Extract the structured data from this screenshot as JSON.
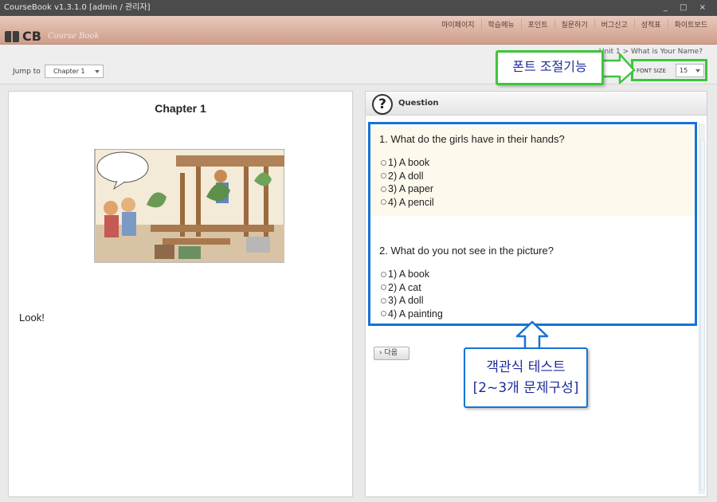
{
  "window": {
    "title": "CourseBook v1.3.1.0 [admin / 관리자]",
    "controls": "_ □ ×"
  },
  "header": {
    "logo_text": "CB",
    "logo_script": "Course Book",
    "menu": [
      "마이페이지",
      "학습메뉴",
      "포인트",
      "질문하기",
      "버그신고",
      "성적표",
      "화이트보드"
    ]
  },
  "toolbar": {
    "jump_label": "Jump to",
    "chapter_value": "Chapter 1",
    "breadcrumb": "Unit 1 > What is Your Name?",
    "font_size_label": "FONT SIZE",
    "font_size_value": "15"
  },
  "left": {
    "chapter_title": "Chapter 1",
    "caption": "Look!"
  },
  "right": {
    "section_title": "Question",
    "questions": [
      {
        "text": "1. What do the girls have in their hands?",
        "options": [
          "1) A book",
          "2) A doll",
          "3) A paper",
          "4) A pencil"
        ]
      },
      {
        "text": "2. What do you not see in the picture?",
        "options": [
          "1) A book",
          "2) A cat",
          "3) A doll",
          "4) A painting"
        ]
      }
    ],
    "next_label": "다음"
  },
  "annotations": {
    "font_control": "폰트 조절기능",
    "test_line1": "객관식 테스트",
    "test_line2": "[2~3개 문제구성]",
    "blue_color": "#1673d6",
    "green_color": "#3cc63b"
  }
}
